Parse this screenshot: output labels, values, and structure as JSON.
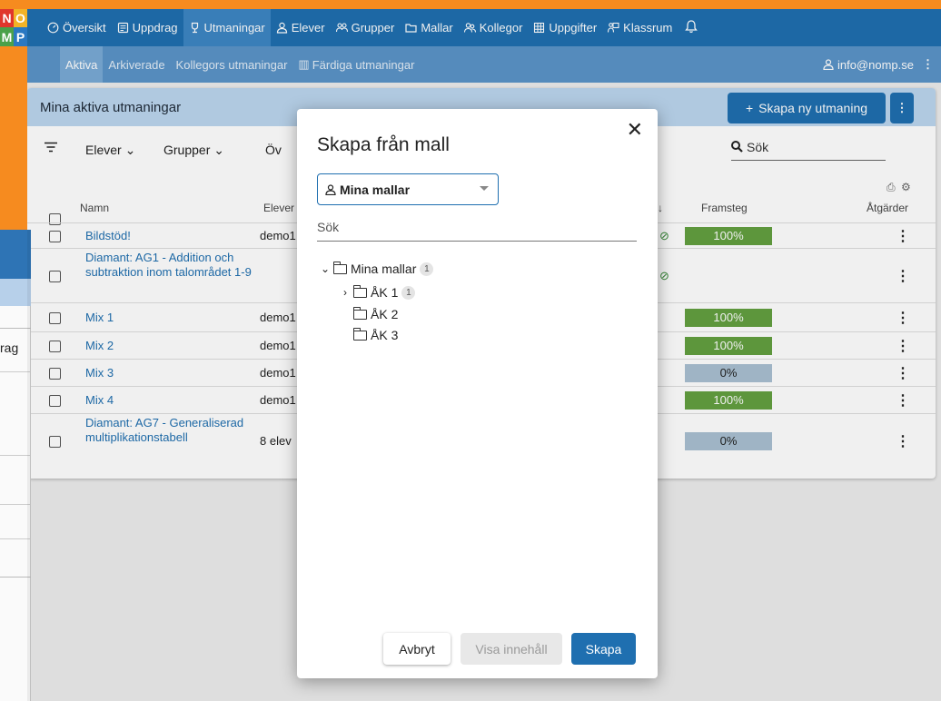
{
  "logo": {
    "letters": [
      "N",
      "O",
      "M",
      "P"
    ],
    "colors": [
      "#e0362c",
      "#f2b326",
      "#4aa14a",
      "#2a78c2"
    ]
  },
  "nav": {
    "items": [
      {
        "label": "Översikt",
        "icon": "dashboard-icon"
      },
      {
        "label": "Uppdrag",
        "icon": "document-icon"
      },
      {
        "label": "Utmaningar",
        "icon": "trophy-icon",
        "active": true
      },
      {
        "label": "Elever",
        "icon": "person-icon"
      },
      {
        "label": "Grupper",
        "icon": "group-icon"
      },
      {
        "label": "Mallar",
        "icon": "folder-icon"
      },
      {
        "label": "Kollegor",
        "icon": "colleagues-icon"
      },
      {
        "label": "Uppgifter",
        "icon": "grid-icon"
      },
      {
        "label": "Klassrum",
        "icon": "classroom-icon"
      }
    ],
    "bell_icon": "bell-icon"
  },
  "subnav": {
    "items": [
      "Aktiva",
      "Arkiverade",
      "Kollegors utmaningar",
      "Färdiga utmaningar"
    ],
    "user": "info@nomp.se"
  },
  "card": {
    "title": "Mina aktiva utmaningar",
    "create_label": "Skapa ny utmaning",
    "filters": [
      "Elever",
      "Grupper",
      "Öv"
    ],
    "search_label": "Sök",
    "columns": {
      "name": "Namn",
      "students": "Elever",
      "progress": "Framsteg",
      "actions": "Åtgärder"
    },
    "rows": [
      {
        "name": "Bildstöd!",
        "students": "demo1",
        "check": true,
        "progress": "100%",
        "pct": 100
      },
      {
        "name": "Diamant: AG1 - Addition och subtraktion inom talområdet 1-9",
        "students": "",
        "check": true,
        "progress": "",
        "pct": null
      },
      {
        "name": "Mix 1",
        "students": "demo1",
        "check": false,
        "progress": "100%",
        "pct": 100
      },
      {
        "name": "Mix 2",
        "students": "demo1",
        "check": false,
        "progress": "100%",
        "pct": 100
      },
      {
        "name": "Mix 3",
        "students": "demo1",
        "check": false,
        "progress": "0%",
        "pct": 0
      },
      {
        "name": "Mix 4",
        "students": "demo1",
        "check": false,
        "progress": "100%",
        "pct": 100
      },
      {
        "name": "Diamant: AG7 - Generaliserad multiplikationstabell",
        "students": "8 elev",
        "check": false,
        "progress": "0%",
        "pct": 0
      }
    ]
  },
  "sliver_text": "rag",
  "dialog": {
    "title": "Skapa från mall",
    "select_value": "Mina mallar",
    "search_placeholder": "Sök",
    "tree": {
      "root": {
        "label": "Mina mallar",
        "count": "1"
      },
      "children": [
        {
          "label": "ÅK 1",
          "count": "1",
          "expandable": true
        },
        {
          "label": "ÅK 2",
          "count": "",
          "expandable": false
        },
        {
          "label": "ÅK 3",
          "count": "",
          "expandable": false
        }
      ]
    },
    "buttons": {
      "cancel": "Avbryt",
      "view": "Visa innehåll",
      "create": "Skapa"
    }
  }
}
